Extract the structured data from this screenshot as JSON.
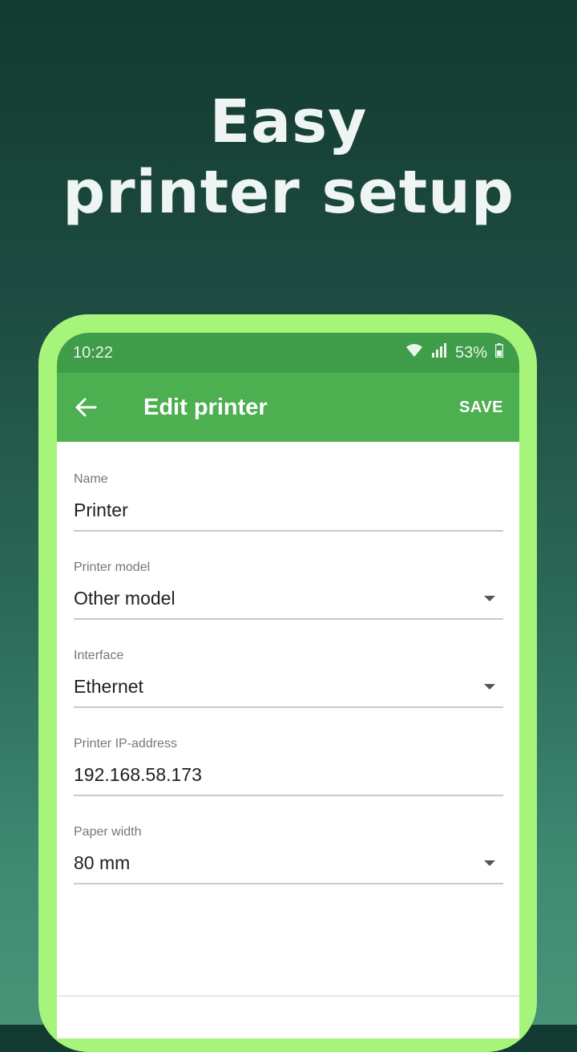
{
  "headline": {
    "line1": "Easy",
    "line2": "printer setup"
  },
  "status_bar": {
    "time": "10:22",
    "battery": "53%"
  },
  "app_bar": {
    "title": "Edit printer",
    "save_label": "SAVE"
  },
  "fields": [
    {
      "label": "Name",
      "value": "Printer",
      "type": "text"
    },
    {
      "label": "Printer model",
      "value": "Other model",
      "type": "dropdown"
    },
    {
      "label": "Interface",
      "value": "Ethernet",
      "type": "dropdown"
    },
    {
      "label": "Printer IP-address",
      "value": "192.168.58.173",
      "type": "text"
    },
    {
      "label": "Paper width",
      "value": "80 mm",
      "type": "dropdown"
    }
  ],
  "colors": {
    "frame": "#a6f57a",
    "app_bar": "#4caf50",
    "status_bar": "#3f9c48"
  }
}
